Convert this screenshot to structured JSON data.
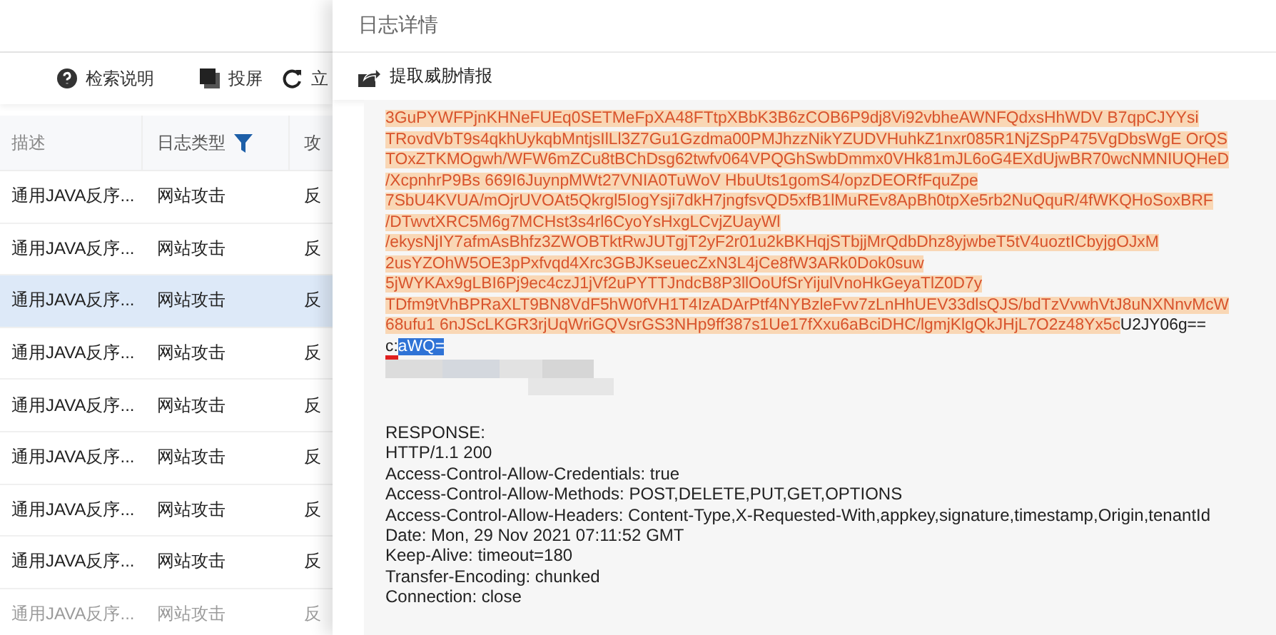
{
  "toolbar": {
    "items": [
      {
        "kind": "help",
        "label": "检索说明"
      },
      {
        "kind": "screen",
        "label": "投屏"
      },
      {
        "kind": "refresh",
        "label": "立"
      }
    ]
  },
  "table": {
    "columns": [
      {
        "label": "描述"
      },
      {
        "label": "日志类型"
      },
      {
        "label": "攻"
      }
    ],
    "rows": [
      {
        "cells": [
          "通用JAVA反序...",
          "网站攻击",
          "反"
        ],
        "selected": false
      },
      {
        "cells": [
          "通用JAVA反序...",
          "网站攻击",
          "反"
        ],
        "selected": false
      },
      {
        "cells": [
          "通用JAVA反序...",
          "网站攻击",
          "反"
        ],
        "selected": true
      },
      {
        "cells": [
          "通用JAVA反序...",
          "网站攻击",
          "反"
        ],
        "selected": false
      },
      {
        "cells": [
          "通用JAVA反序...",
          "网站攻击",
          "反"
        ],
        "selected": false
      },
      {
        "cells": [
          "通用JAVA反序...",
          "网站攻击",
          "反"
        ],
        "selected": false
      },
      {
        "cells": [
          "通用JAVA反序...",
          "网站攻击",
          "反"
        ],
        "selected": false
      },
      {
        "cells": [
          "通用JAVA反序...",
          "网站攻击",
          "反"
        ],
        "selected": false
      },
      {
        "cells": [
          "通用JAVA反序...",
          "网站攻击",
          "反"
        ],
        "selected": false
      }
    ]
  },
  "drawer": {
    "title": "日志详情",
    "action": "提取威胁情报",
    "highlighted_lines": [
      "3GuPYWFPjnKHNeFUEq0SETMeFpXA48FTtpXBbK3B6zCOB6P9dj8Vi92vbheAWNFQdxsHhWDV B7qpCJYYsi",
      "TRovdVbT9s4qkhUykqbMntjsIlLl3Z7Gu1Gzdma00PMJhzzNikYZUDVHuhkZ1nxr085R1NjZSpP475VgDbsWgE OrQS",
      "TOxZTKMOgwh/WFW6mZCu8tBChDsg62twfv064VPQGhSwbDmmx0VHk81mJL6oG4EXdUjwBR70wcNMNIUQHeD",
      "/XcpnhrP9Bs 669I6JuynpMWt27VNIA0TuWoV HbuUts1gomS4/opzDEORfFquZpe",
      "7SbU4KVUA/mOjrUVOAt5Qkrgl5IogYsji7dkH7jngfsvQD5xfB1lMuREv8ApBh0tpXe5rb2NuQquR/4fWKQHoSoxBRF",
      "/DTwvtXRC5M6g7MCHst3s4rl6CyoYsHxgLCvjZUayWl",
      "/ekysNjIY7afmAsBhfz3ZWOBTktRwJUTgjT2yF2r01u2kBKHqjSTbjjMrQdbDhz8yjwbeT5tV4uoztICbyjgOJxM",
      "2usYZOhW5OE3pPxfvqd4Xrc3GBJKseuecZxN3L4jCe8fW3ARk0Dok0suw",
      "5jWYKAx9gLBI6Pj9ec4czJ1jVf2uPYTTJndcB8P3llOoUfSrYijulVnoHkGeyaTlZ0D7y",
      "TDfm9tVhBPRaXLT9BN8VdF5hW0fVH1T4IzADArPtf4NYBzleFvv7zLnHhUEV33dlsQJS/bdTzVvwhVtJ8uNXNnvMcW",
      "68ufu1 6nJScLKGR3rjUqWriGQVsrGS3NHp9ff387s1Ue17fXxu6aBciDHC/lgmjKlgQkJHjL7O2z48Yx5c"
    ],
    "tail": "U2JY06g==",
    "selection_prefix": "c:",
    "selection": "aWQ=",
    "response_lines": [
      "RESPONSE:",
      "HTTP/1.1 200",
      "Access-Control-Allow-Credentials: true",
      "Access-Control-Allow-Methods: POST,DELETE,PUT,GET,OPTIONS",
      "Access-Control-Allow-Headers: Content-Type,X-Requested-With,appkey,signature,timestamp,Origin,tenantId",
      "Date: Mon, 29 Nov 2021 07:11:52 GMT",
      "Keep-Alive: timeout=180",
      "Transfer-Encoding: chunked",
      "Connection: close"
    ]
  }
}
